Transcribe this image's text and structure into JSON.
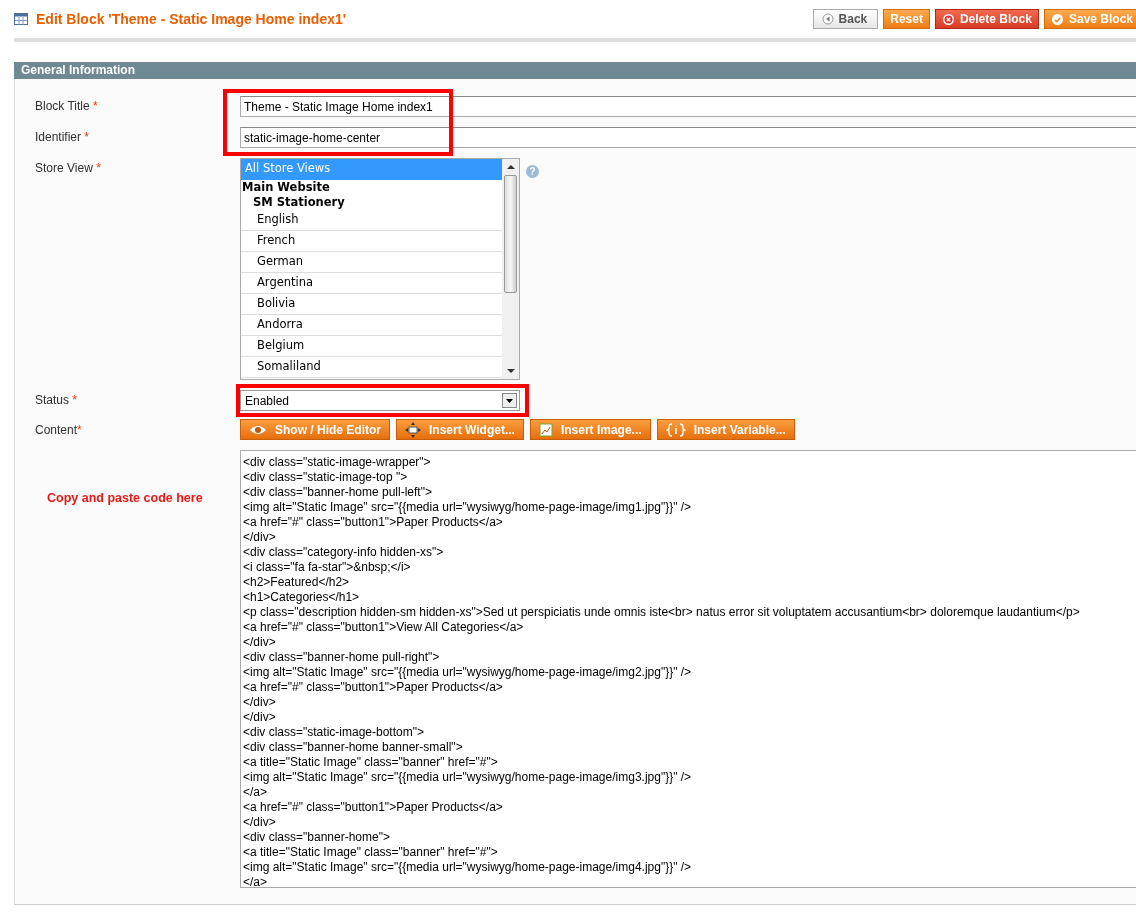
{
  "header": {
    "title": "Edit Block 'Theme - Static Image Home index1'",
    "buttons": [
      {
        "label": "Back",
        "kind": "back"
      },
      {
        "label": "Reset",
        "kind": "reset"
      },
      {
        "label": "Delete Block",
        "kind": "delete"
      },
      {
        "label": "Save Block",
        "kind": "save"
      }
    ]
  },
  "section": {
    "title": "General Information"
  },
  "fields": {
    "block_title": {
      "label": "Block Title",
      "required_mark": "*",
      "value": "Theme - Static Image Home index1"
    },
    "identifier": {
      "label": "Identifier",
      "required_mark": "*",
      "value": "static-image-home-center"
    },
    "store_view": {
      "label": "Store View",
      "required_mark": "*",
      "help": "?",
      "options": [
        {
          "label": "All Store Views",
          "selected": true
        },
        {
          "label": "Main Website",
          "kind": "group",
          "children": [
            {
              "label": "SM Stationery",
              "kind": "group",
              "children": [
                {
                  "label": "English",
                  "selected": false
                },
                {
                  "label": "French",
                  "selected": false
                },
                {
                  "label": "German",
                  "selected": false
                },
                {
                  "label": "Argentina",
                  "selected": false
                },
                {
                  "label": "Bolivia",
                  "selected": false
                },
                {
                  "label": "Andorra",
                  "selected": false
                },
                {
                  "label": "Belgium",
                  "selected": false
                },
                {
                  "label": "Somaliland",
                  "selected": false
                }
              ]
            }
          ]
        }
      ]
    },
    "status": {
      "label": "Status",
      "required_mark": "*",
      "value": "Enabled"
    },
    "content": {
      "label": "Content",
      "required_mark": "*",
      "buttons": [
        {
          "label": "Show / Hide Editor",
          "kind": "toggle"
        },
        {
          "label": "Insert Widget...",
          "kind": "widget"
        },
        {
          "label": "Insert Image...",
          "kind": "image"
        },
        {
          "label": "Insert Variable...",
          "kind": "variable"
        }
      ],
      "note": "Copy and paste code here",
      "lines": [
        "<div class=\"static-image-wrapper\">",
        "<div class=\"static-image-top \">",
        "<div class=\"banner-home pull-left\">",
        "<img alt=\"Static Image\" src=\"{{media url=\"wysiwyg/home-page-image/img1.jpg\"}}\" />",
        "<a href=\"#\" class=\"button1\">Paper Products</a>",
        "</div>",
        "<div class=\"category-info hidden-xs\">",
        "<i class=\"fa fa-star\">&nbsp;</i>",
        "<h2>Featured</h2>",
        "<h1>Categories</h1>",
        "<p class=\"description hidden-sm hidden-xs\">Sed ut perspiciatis unde omnis iste<br> natus error sit voluptatem accusantium<br> doloremque laudantium</p>",
        "<a href=\"#\" class=\"button1\">View All Categories</a>",
        "</div>",
        "<div class=\"banner-home pull-right\">",
        "<img alt=\"Static Image\" src=\"{{media url=\"wysiwyg/home-page-image/img2.jpg\"}}\" />",
        "<a href=\"#\" class=\"button1\">Paper Products</a>",
        "</div>",
        "</div>",
        "<div class=\"static-image-bottom\">",
        "<div class=\"banner-home banner-small\">",
        "<a title=\"Static Image\" class=\"banner\" href=\"#\">",
        "<img alt=\"Static Image\" src=\"{{media url=\"wysiwyg/home-page-image/img3.jpg\"}}\" />",
        "</a>",
        "<a href=\"#\" class=\"button1\">Paper Products</a>",
        "</div>",
        "<div class=\"banner-home\">",
        "<a title=\"Static Image\" class=\"banner\" href=\"#\">",
        "<img alt=\"Static Image\" src=\"{{media url=\"wysiwyg/home-page-image/img4.jpg\"}}\" />",
        "</a>"
      ]
    }
  }
}
